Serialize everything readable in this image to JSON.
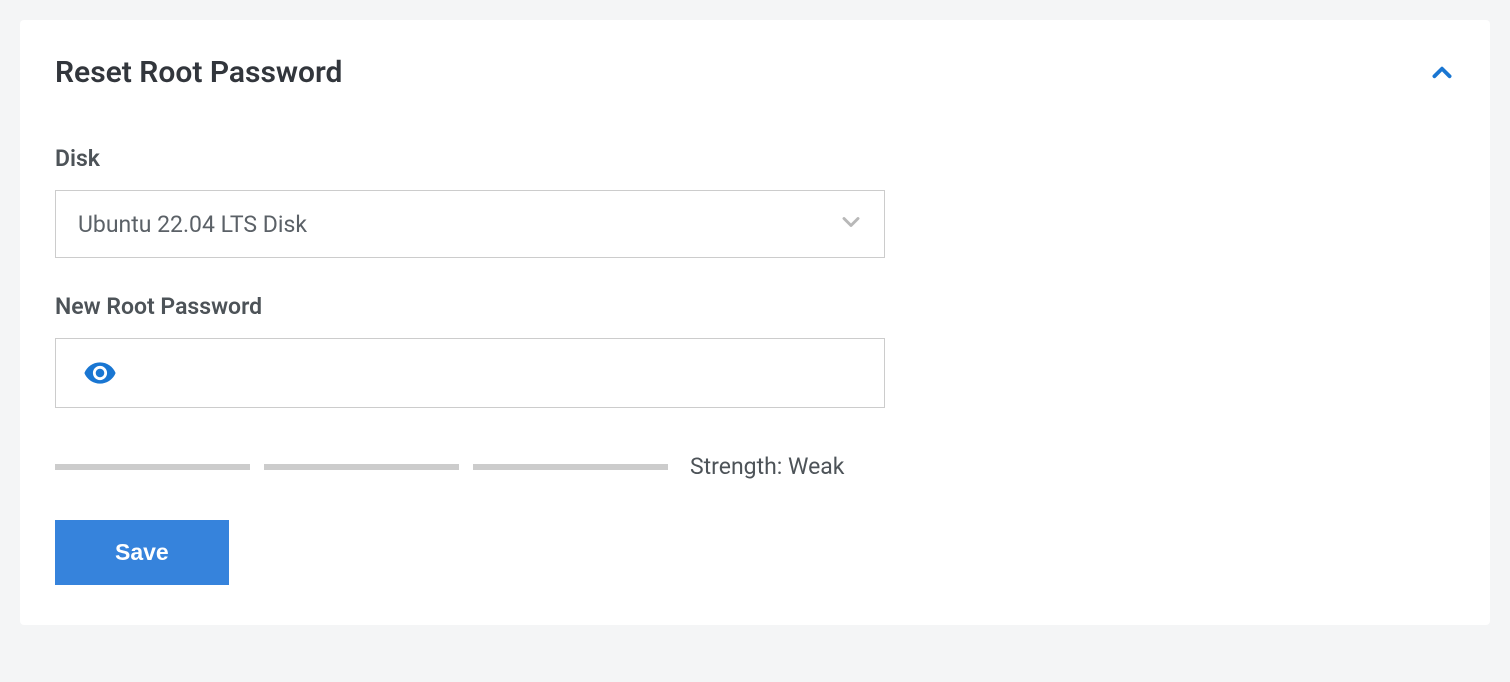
{
  "panel": {
    "title": "Reset Root Password"
  },
  "disk": {
    "label": "Disk",
    "selected": "Ubuntu 22.04 LTS Disk"
  },
  "password": {
    "label": "New Root Password",
    "value": "",
    "strength_prefix": "Strength: ",
    "strength_value": "Weak"
  },
  "actions": {
    "save": "Save"
  },
  "icons": {
    "collapse": "chevron-up",
    "select_chevron": "chevron-down",
    "eye": "eye"
  }
}
